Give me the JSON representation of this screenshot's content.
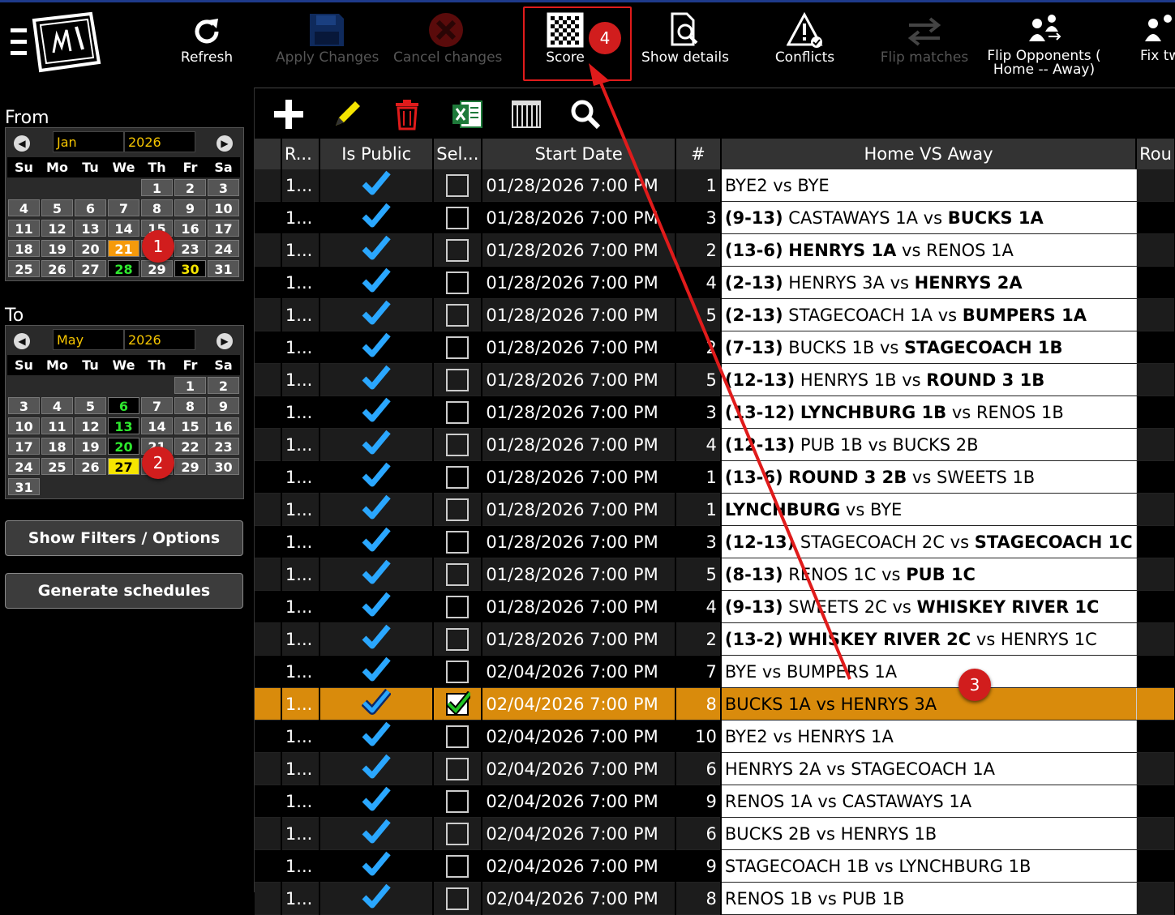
{
  "toolbar": {
    "refresh": "Refresh",
    "apply_changes": "Apply Changes",
    "cancel_changes": "Cancel changes",
    "score": "Score",
    "show_details": "Show details",
    "conflicts": "Conflicts",
    "flip_matches": "Flip matches",
    "flip_opponents_line1": "Flip Opponents (",
    "flip_opponents_line2": "Home -- Away)",
    "fix": "Fix tw"
  },
  "from": {
    "label": "From",
    "month": "Jan",
    "year": "2026",
    "weekdays": [
      "Su",
      "Mo",
      "Tu",
      "We",
      "Th",
      "Fr",
      "Sa"
    ],
    "days": [
      "",
      "",
      "",
      "",
      "1",
      "2",
      "3",
      "4",
      "5",
      "6",
      "7",
      "8",
      "9",
      "10",
      "11",
      "12",
      "13",
      "14",
      "15",
      "16",
      "17",
      "18",
      "19",
      "20",
      "21",
      "22",
      "23",
      "24",
      "25",
      "26",
      "27",
      "28",
      "29",
      "30",
      "31"
    ]
  },
  "to": {
    "label": "To",
    "month": "May",
    "year": "2026",
    "weekdays": [
      "Su",
      "Mo",
      "Tu",
      "We",
      "Th",
      "Fr",
      "Sa"
    ],
    "days": [
      "",
      "",
      "",
      "",
      "",
      "1",
      "2",
      "3",
      "4",
      "5",
      "6",
      "7",
      "8",
      "9",
      "10",
      "11",
      "12",
      "13",
      "14",
      "15",
      "16",
      "17",
      "18",
      "19",
      "20",
      "21",
      "22",
      "23",
      "24",
      "25",
      "26",
      "27",
      "28",
      "29",
      "30",
      "31"
    ]
  },
  "buttons": {
    "show_filters": "Show Filters / Options",
    "generate": "Generate schedules"
  },
  "columns": [
    "R...",
    "Is Public",
    "Sel...",
    "Start Date",
    "#",
    "Home VS Away",
    "Rou"
  ],
  "rows": [
    {
      "r": "1...",
      "date": "01/28/2026 7:00 PM",
      "num": "1",
      "score": "",
      "home": "BYE2",
      "home_bold": false,
      "away": "BYE",
      "away_bold": false
    },
    {
      "r": "1...",
      "date": "01/28/2026 7:00 PM",
      "num": "3",
      "score": "(9-13)",
      "home": "CASTAWAYS 1A",
      "home_bold": false,
      "away": "BUCKS 1A",
      "away_bold": true
    },
    {
      "r": "1...",
      "date": "01/28/2026 7:00 PM",
      "num": "2",
      "score": "(13-6)",
      "home": "HENRYS 1A",
      "home_bold": true,
      "away": "RENOS 1A",
      "away_bold": false
    },
    {
      "r": "1...",
      "date": "01/28/2026 7:00 PM",
      "num": "4",
      "score": "(2-13)",
      "home": "HENRYS 3A",
      "home_bold": false,
      "away": "HENRYS 2A",
      "away_bold": true
    },
    {
      "r": "1...",
      "date": "01/28/2026 7:00 PM",
      "num": "5",
      "score": "(2-13)",
      "home": "STAGECOACH 1A",
      "home_bold": false,
      "away": "BUMPERS 1A",
      "away_bold": true
    },
    {
      "r": "1...",
      "date": "01/28/2026 7:00 PM",
      "num": "2",
      "score": "(7-13)",
      "home": "BUCKS 1B",
      "home_bold": false,
      "away": "STAGECOACH 1B",
      "away_bold": true
    },
    {
      "r": "1...",
      "date": "01/28/2026 7:00 PM",
      "num": "5",
      "score": "(12-13)",
      "home": "HENRYS 1B",
      "home_bold": false,
      "away": "ROUND 3 1B",
      "away_bold": true
    },
    {
      "r": "1...",
      "date": "01/28/2026 7:00 PM",
      "num": "3",
      "score": "(13-12)",
      "home": "LYNCHBURG 1B",
      "home_bold": true,
      "away": "RENOS 1B",
      "away_bold": false
    },
    {
      "r": "1...",
      "date": "01/28/2026 7:00 PM",
      "num": "4",
      "score": "(12-13)",
      "home": "PUB 1B",
      "home_bold": false,
      "away": "BUCKS 2B",
      "away_bold": false
    },
    {
      "r": "1...",
      "date": "01/28/2026 7:00 PM",
      "num": "1",
      "score": "(13-6)",
      "home": "ROUND 3 2B",
      "home_bold": true,
      "away": "SWEETS 1B",
      "away_bold": false
    },
    {
      "r": "1...",
      "date": "01/28/2026 7:00 PM",
      "num": "1",
      "score": "",
      "home": "LYNCHBURG",
      "home_bold": true,
      "away": "BYE",
      "away_bold": false
    },
    {
      "r": "1...",
      "date": "01/28/2026 7:00 PM",
      "num": "3",
      "score": "(12-13)",
      "home": "STAGECOACH 2C",
      "home_bold": false,
      "away": "STAGECOACH 1C",
      "away_bold": true
    },
    {
      "r": "1...",
      "date": "01/28/2026 7:00 PM",
      "num": "5",
      "score": "(8-13)",
      "home": "RENOS 1C",
      "home_bold": false,
      "away": "PUB 1C",
      "away_bold": true
    },
    {
      "r": "1...",
      "date": "01/28/2026 7:00 PM",
      "num": "4",
      "score": "(9-13)",
      "home": "SWEETS 2C",
      "home_bold": false,
      "away": "WHISKEY RIVER 1C",
      "away_bold": true
    },
    {
      "r": "1...",
      "date": "01/28/2026 7:00 PM",
      "num": "2",
      "score": "(13-2)",
      "home": "WHISKEY RIVER 2C",
      "home_bold": true,
      "away": "HENRYS 1C",
      "away_bold": false
    },
    {
      "r": "1...",
      "date": "02/04/2026 7:00 PM",
      "num": "7",
      "score": "",
      "home": "BYE",
      "home_bold": false,
      "away": "BUMPERS 1A",
      "away_bold": false
    },
    {
      "r": "1...",
      "date": "02/04/2026 7:00 PM",
      "num": "8",
      "score": "",
      "home": "BUCKS 1A",
      "home_bold": false,
      "away": "HENRYS 3A",
      "away_bold": false,
      "selected": true
    },
    {
      "r": "1...",
      "date": "02/04/2026 7:00 PM",
      "num": "10",
      "score": "",
      "home": "BYE2",
      "home_bold": false,
      "away": "HENRYS 1A",
      "away_bold": false
    },
    {
      "r": "1...",
      "date": "02/04/2026 7:00 PM",
      "num": "6",
      "score": "",
      "home": "HENRYS 2A",
      "home_bold": false,
      "away": "STAGECOACH 1A",
      "away_bold": false
    },
    {
      "r": "1...",
      "date": "02/04/2026 7:00 PM",
      "num": "9",
      "score": "",
      "home": "RENOS 1A",
      "home_bold": false,
      "away": "CASTAWAYS 1A",
      "away_bold": false
    },
    {
      "r": "1...",
      "date": "02/04/2026 7:00 PM",
      "num": "6",
      "score": "",
      "home": "BUCKS 2B",
      "home_bold": false,
      "away": "HENRYS 1B",
      "away_bold": false
    },
    {
      "r": "1...",
      "date": "02/04/2026 7:00 PM",
      "num": "9",
      "score": "",
      "home": "STAGECOACH 1B",
      "home_bold": false,
      "away": "LYNCHBURG 1B",
      "away_bold": false
    },
    {
      "r": "1...",
      "date": "02/04/2026 7:00 PM",
      "num": "8",
      "score": "",
      "home": "RENOS 1B",
      "home_bold": false,
      "away": "PUB 1B",
      "away_bold": false
    }
  ],
  "vs_word": "vs",
  "annotations": [
    "1",
    "2",
    "3",
    "4"
  ],
  "colors": {
    "selected_row": "#d98b0c",
    "check": "#2aa7ff",
    "annotation": "#d11d1d",
    "today": "#f59a0c",
    "highlight_green": "#2ee82e",
    "highlight_yellow": "#f5e400"
  }
}
